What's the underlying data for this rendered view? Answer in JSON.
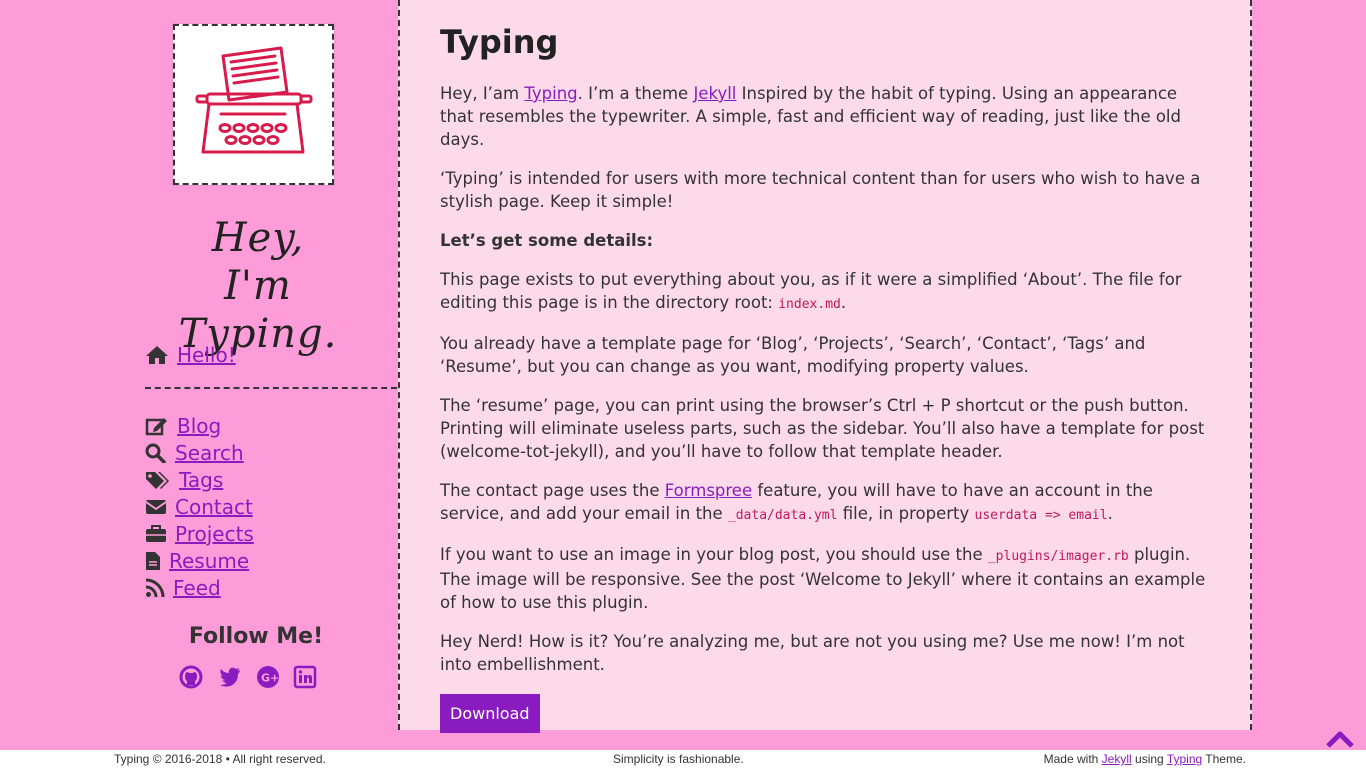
{
  "sidebar": {
    "hand_title_line1": "Hey,",
    "hand_title_line2": "I'm Typing.",
    "home_link": "Hello!",
    "nav": [
      {
        "label": "Blog",
        "icon": "edit-icon"
      },
      {
        "label": "Search",
        "icon": "search-icon"
      },
      {
        "label": "Tags",
        "icon": "tags-icon"
      },
      {
        "label": "Contact",
        "icon": "envelope-icon"
      },
      {
        "label": "Projects",
        "icon": "briefcase-icon"
      },
      {
        "label": "Resume",
        "icon": "file-icon"
      },
      {
        "label": "Feed",
        "icon": "rss-icon"
      }
    ],
    "follow_title": "Follow Me!",
    "social": [
      "github-icon",
      "twitter-icon",
      "google-plus-icon",
      "linkedin-icon"
    ]
  },
  "content": {
    "title": "Typing",
    "p1": {
      "pre": "Hey, I’am ",
      "link1": "Typing",
      "mid": ". I’m a theme ",
      "link2": "Jekyll",
      "post": " Inspired by the habit of typing. Using an appearance that resembles the typewriter. A simple, fast and efficient way of reading, just like the old days."
    },
    "p2": "‘Typing’ is intended for users with more technical content than for users who wish to have a stylish page. Keep it simple!",
    "p3": "Let’s get some details:",
    "p4": {
      "pre": "This page exists to put everything about you, as if it were a simplified ‘About’. The file for editing this page is in the directory root: ",
      "code": "index.md",
      "post": "."
    },
    "p5": "You already have a template page for ‘Blog’, ‘Projects’, ‘Search’, ‘Contact’, ‘Tags’ and ‘Resume’, but you can change as you want, modifying property values.",
    "p6": "The ‘resume’ page, you can print using the browser’s Ctrl + P shortcut or the push button. Printing will eliminate useless parts, such as the sidebar. You’ll also have a template for post (welcome-tot-jekyll), and you’ll have to follow that template header.",
    "p7": {
      "pre": "The contact page uses the ",
      "link": "Formspree",
      "mid": " feature, you will have to have an account in the service, and add your email in the ",
      "code1": "_data/data.yml",
      "mid2": " file, in property ",
      "code2": "userdata => email",
      "post": "."
    },
    "p8": {
      "pre": "If you want to use an image in your blog post, you should use the ",
      "code": "_plugins/imager.rb",
      "post": " plugin. The image will be responsive. See the post ‘Welcome to Jekyll’ where it contains an example of how to use this plugin."
    },
    "p9": "Hey Nerd! How is it? You’re analyzing me, but are not you using me? Use me now! I’m not into embellishment.",
    "download_label": "Download"
  },
  "footer": {
    "left": "Typing © 2016-2018 • All right reserved.",
    "center": "Simplicity is fashionable.",
    "right_pre": "Made with ",
    "right_link1": "Jekyll",
    "right_mid": " using ",
    "right_link2": "Typing",
    "right_post": " Theme."
  },
  "colors": {
    "page_bg": "#fd9cd9",
    "content_bg": "#fddaea",
    "link": "#8a1cbf",
    "logo_red": "#d81b4a",
    "code": "#c2185b"
  }
}
